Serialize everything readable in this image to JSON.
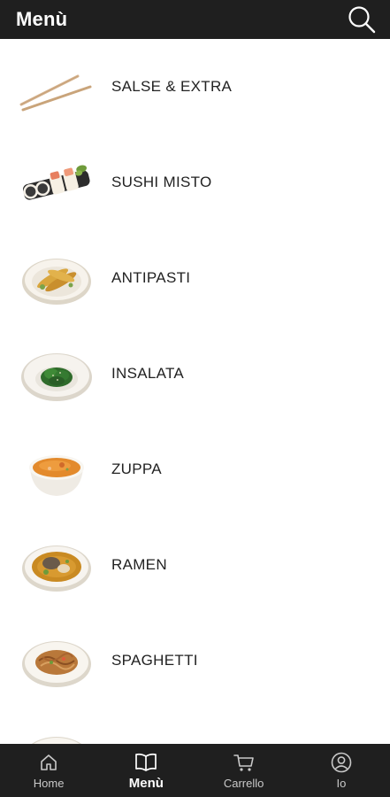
{
  "header": {
    "title": "Menù",
    "search_icon": "search-icon"
  },
  "categories": [
    {
      "label": "SALSE & EXTRA",
      "icon": "chopsticks-image"
    },
    {
      "label": "SUSHI MISTO",
      "icon": "sushi-roll-image"
    },
    {
      "label": "ANTIPASTI",
      "icon": "tempura-plate-image"
    },
    {
      "label": "INSALATA",
      "icon": "seaweed-salad-image"
    },
    {
      "label": "ZUPPA",
      "icon": "soup-bowl-image"
    },
    {
      "label": "RAMEN",
      "icon": "ramen-bowl-image"
    },
    {
      "label": "SPAGHETTI",
      "icon": "noodle-plate-image"
    }
  ],
  "bottom_nav": {
    "items": [
      {
        "label": "Home",
        "icon": "home-icon",
        "active": false
      },
      {
        "label": "Menù",
        "icon": "book-icon",
        "active": true
      },
      {
        "label": "Carrello",
        "icon": "cart-icon",
        "active": false
      },
      {
        "label": "Io",
        "icon": "profile-icon",
        "active": false
      }
    ]
  },
  "colors": {
    "bar_background": "#1f1f1f",
    "text": "#222222",
    "nav_inactive": "#c9c9c9",
    "nav_active": "#ffffff"
  }
}
